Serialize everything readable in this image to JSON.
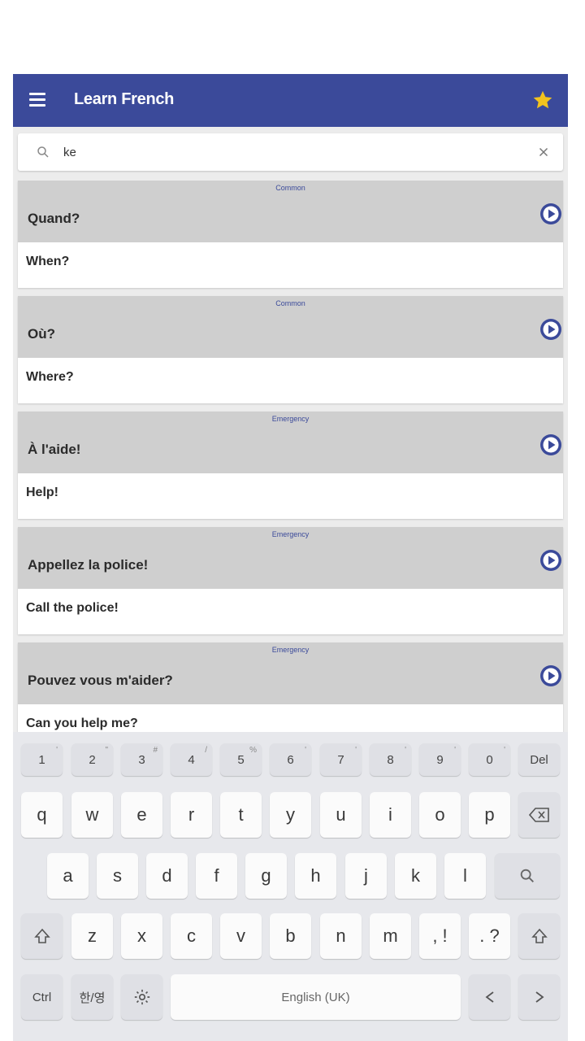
{
  "app": {
    "title": "Learn French",
    "colors": {
      "primary": "#3b4a9a",
      "star": "#f2c31e",
      "card_header": "#cfcfcf"
    },
    "icons": {
      "menu": "menu-icon",
      "favorite": "star-icon",
      "search": "search-icon",
      "clear": "close-icon",
      "play": "play-circle-icon"
    }
  },
  "search": {
    "value": "ke"
  },
  "phrases": [
    {
      "category": "Common",
      "french": "Quand?",
      "english": "When?"
    },
    {
      "category": "Common",
      "french": "Où?",
      "english": "Where?"
    },
    {
      "category": "Emergency",
      "french": "À l'aide!",
      "english": "Help!"
    },
    {
      "category": "Emergency",
      "french": "Appellez la police!",
      "english": "Call the police!"
    },
    {
      "category": "Emergency",
      "french": "Pouvez vous m'aider?",
      "english": "Can you help me?"
    }
  ],
  "keyboard": {
    "number_row": [
      {
        "label": "1",
        "hint": "'"
      },
      {
        "label": "2",
        "hint": "\""
      },
      {
        "label": "3",
        "hint": "#"
      },
      {
        "label": "4",
        "hint": "/"
      },
      {
        "label": "5",
        "hint": "%"
      },
      {
        "label": "6",
        "hint": "'"
      },
      {
        "label": "7",
        "hint": "'"
      },
      {
        "label": "8",
        "hint": "'"
      },
      {
        "label": "9",
        "hint": "'"
      },
      {
        "label": "0",
        "hint": "'"
      }
    ],
    "del_label": "Del",
    "row1": [
      "q",
      "w",
      "e",
      "r",
      "t",
      "y",
      "u",
      "i",
      "o",
      "p"
    ],
    "row2": [
      "a",
      "s",
      "d",
      "f",
      "g",
      "h",
      "j",
      "k",
      "l"
    ],
    "row3": [
      "z",
      "x",
      "c",
      "v",
      "b",
      "n",
      "m"
    ],
    "comma_label": ", !",
    "period_label": ". ?",
    "ctrl_label": "Ctrl",
    "lang_key_label": "한/영",
    "space_label": "English (UK)"
  }
}
